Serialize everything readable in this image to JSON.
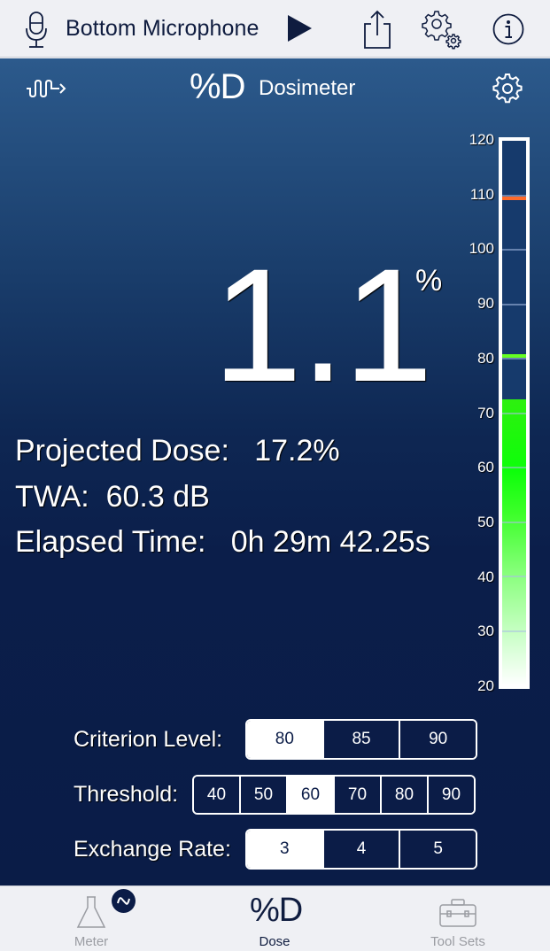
{
  "toolbar": {
    "source_label": "Bottom Microphone",
    "icons": {
      "microphone": "microphone-icon",
      "play": "play-icon",
      "share": "share-icon",
      "settings": "gears-icon",
      "info": "info-icon"
    }
  },
  "header": {
    "logo": "%D",
    "title": "Dosimeter",
    "left_icon": "waveform-arrow-icon",
    "right_icon": "gear-icon"
  },
  "dose": {
    "value": "1.1",
    "unit": "%"
  },
  "stats": {
    "projected_dose": "Projected Dose:   17.2%",
    "twa": "TWA:  60.3 dB",
    "elapsed_time": "Elapsed Time:   0h 29m 42.25s"
  },
  "meter": {
    "scale_min": 20,
    "scale_max": 120,
    "labels": [
      "120",
      "110",
      "100",
      "90",
      "80",
      "70",
      "60",
      "50",
      "40",
      "30",
      "20"
    ],
    "current_level_db": 72.5,
    "markers": [
      {
        "name": "max-marker",
        "value_db": 109.5,
        "color": "#ff6a2a"
      },
      {
        "name": "criterion-marker",
        "value_db": 80.5,
        "color": "#66ff22"
      }
    ]
  },
  "controls": {
    "criterion": {
      "label": "Criterion Level:",
      "options": [
        "80",
        "85",
        "90"
      ],
      "selected": 0
    },
    "threshold": {
      "label": "Threshold:",
      "options": [
        "40",
        "50",
        "60",
        "70",
        "80",
        "90"
      ],
      "selected": 2
    },
    "exchange": {
      "label": "Exchange Rate:",
      "options": [
        "3",
        "4",
        "5"
      ],
      "selected": 0
    }
  },
  "tabbar": {
    "tabs": [
      {
        "label": "Meter",
        "icon": "flask-icon",
        "active": false
      },
      {
        "label": "Dose",
        "icon": "%D",
        "active": true
      },
      {
        "label": "Tool Sets",
        "icon": "toolbox-icon",
        "active": false
      }
    ],
    "badge_icon": "sine-wave-icon"
  },
  "colors": {
    "navy": "#0b1c47",
    "header_blue": "#2c5a8c",
    "meter_green": "#0dff0a",
    "max_orange": "#ff6a2a"
  }
}
